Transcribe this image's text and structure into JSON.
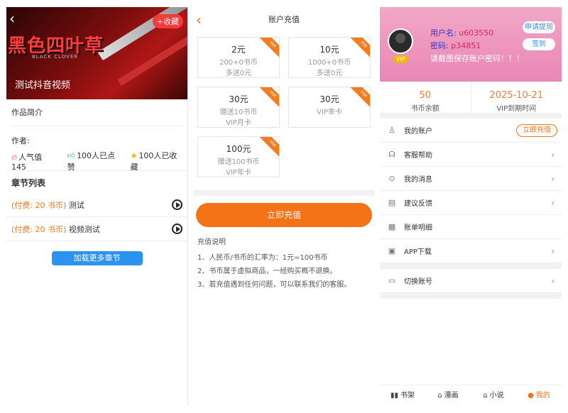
{
  "work": {
    "back_icon": "‹",
    "logo": "黑色四叶草",
    "logo_sub": "BLACK CLOVER",
    "title": "测试抖音视频",
    "collect_label": "+收藏",
    "intro_label": "作品简介",
    "author_label": "作者:",
    "stats": {
      "popularity": "人气值 145",
      "likes": "100人已点赞",
      "favorites": "100人已收藏"
    },
    "chapters_title": "章节列表",
    "chapters": [
      {
        "fee": "(付费: 20 书币)",
        "name": "测试"
      },
      {
        "fee": "(付费: 20 书币)",
        "name": "视频测试"
      }
    ],
    "load_more": "加载更多章节"
  },
  "recharge": {
    "back_icon": "‹",
    "title": "账户充值",
    "hot_label": "Hot",
    "options": [
      {
        "price": "2元",
        "line1": "200+0书币",
        "line2": "多送0元"
      },
      {
        "price": "10元",
        "line1": "1000+0书币",
        "line2": "多送0元"
      },
      {
        "price": "30元",
        "line1": "赠送10书币",
        "line2": "VIP月卡"
      },
      {
        "price": "30元",
        "line1": "VIP季卡",
        "line2": ""
      },
      {
        "price": "100元",
        "line1": "赠送100书币",
        "line2": "VIP年卡"
      }
    ],
    "pay_button": "立即充值",
    "notes_title": "充值说明",
    "notes": [
      "1、人民币/书币的汇率为：1元=100书币",
      "2、书币属于虚拟商品，一经购买概不退换。",
      "3、若充值遇到任何问题，可以联系我们的客服。"
    ]
  },
  "account": {
    "vip_label": "VIP",
    "username_label": "用户名:",
    "username": "u603550",
    "password_label": "密码:",
    "password": "p34851",
    "hint": "请截图保存账户密码！！！",
    "withdraw_button": "申请提现",
    "signin_button": "签到",
    "balance": {
      "value": "50",
      "label": "书币余额"
    },
    "vip_expire": {
      "value": "2025-10-21",
      "label": "VIP到期时间"
    },
    "menu": [
      {
        "label": "我的账户",
        "icon": "user-icon",
        "glyph": "♙",
        "action": "立即充值"
      },
      {
        "label": "客服帮助",
        "icon": "headset-icon",
        "glyph": "☊"
      },
      {
        "label": "我的消息",
        "icon": "message-icon",
        "glyph": "⊙"
      },
      {
        "label": "建议反馈",
        "icon": "feedback-icon",
        "glyph": "▤"
      },
      {
        "label": "账单明细",
        "icon": "bill-icon",
        "glyph": "▦"
      },
      {
        "label": "APP下载",
        "icon": "download-icon",
        "glyph": "▣"
      }
    ],
    "switch_account": {
      "label": "切换账号",
      "icon": "wallet-icon",
      "glyph": "▭"
    },
    "tabs": [
      {
        "label": "书架",
        "glyph": "▮▮"
      },
      {
        "label": "漫画",
        "glyph": "⌂"
      },
      {
        "label": "小说",
        "glyph": "⌂"
      },
      {
        "label": "我的",
        "glyph": "●"
      }
    ]
  }
}
